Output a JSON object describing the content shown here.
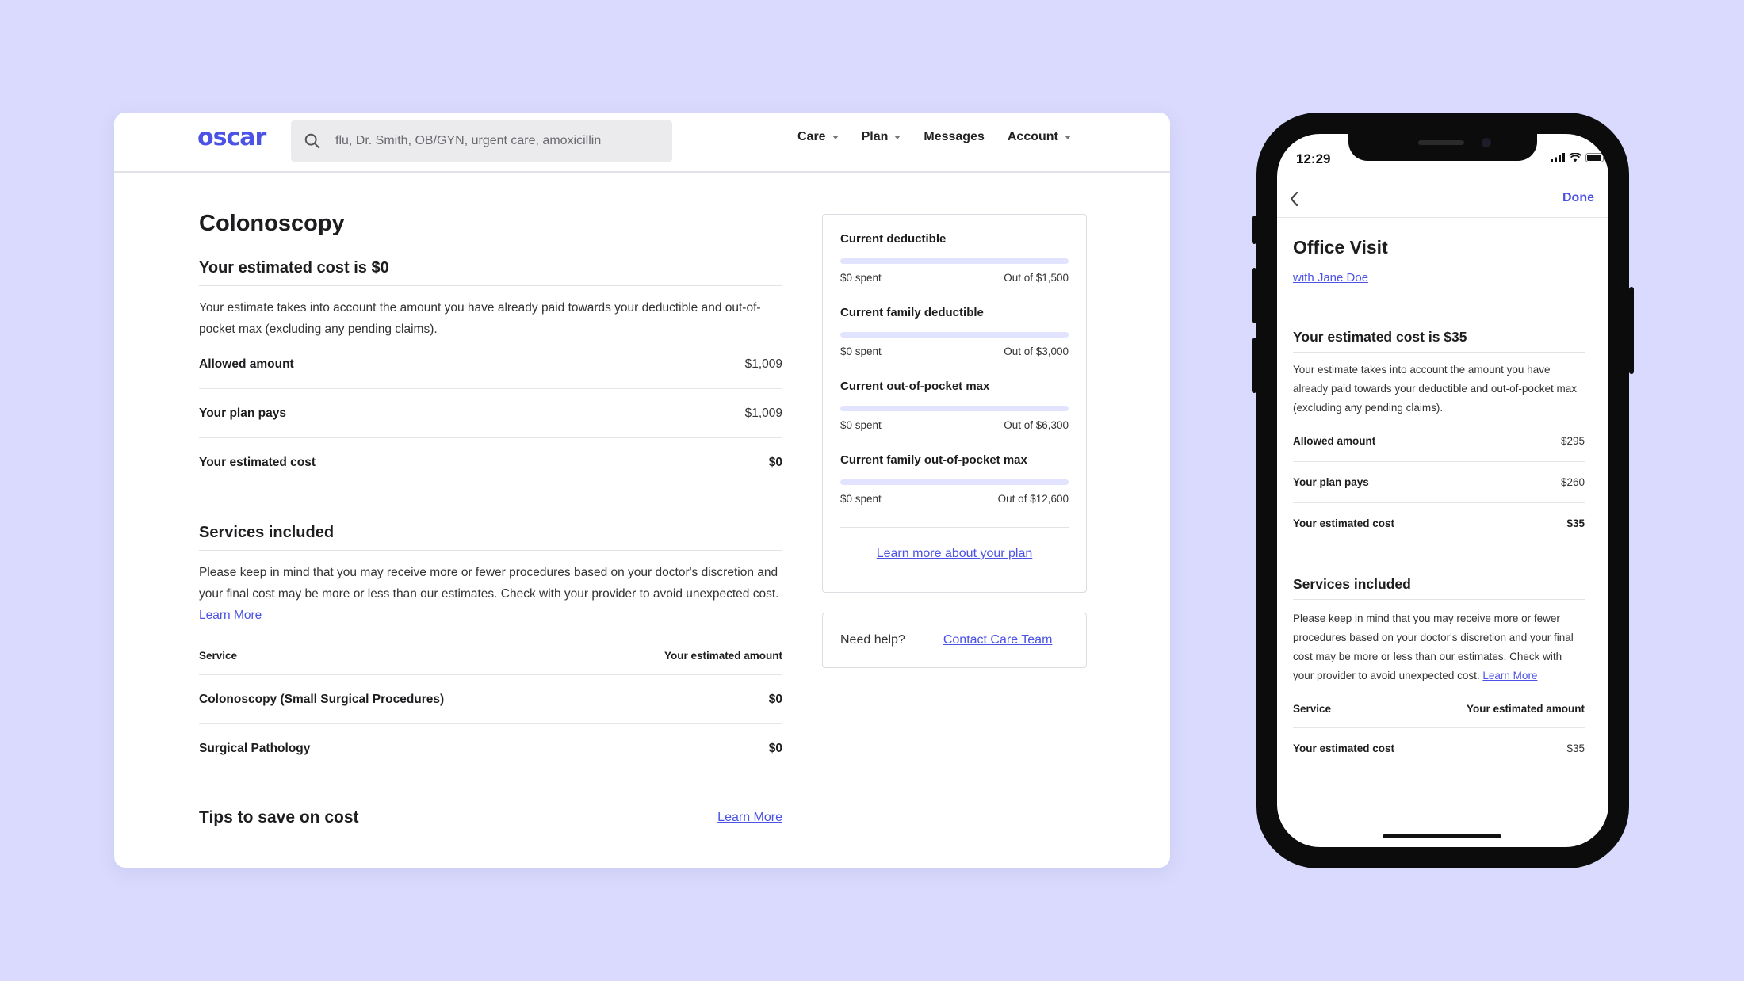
{
  "colors": {
    "accent": "#4c52e3",
    "background": "#d9dafd",
    "meter_track": "#e2e3ff"
  },
  "desktop": {
    "nav": {
      "logo": "oscar",
      "search": {
        "placeholder": "flu, Dr. Smith, OB/GYN, urgent care, amoxicillin",
        "icon": "search-icon"
      },
      "links": [
        {
          "label": "Care",
          "has_caret": true
        },
        {
          "label": "Plan",
          "has_caret": true
        },
        {
          "label": "Messages",
          "has_caret": false
        },
        {
          "label": "Account",
          "has_caret": true
        }
      ]
    },
    "main": {
      "title": "Colonoscopy",
      "estimate_title": "Your estimated cost is $0",
      "estimate_desc": "Your estimate takes into account the amount you have already paid towards your deductible and out-of-pocket max (excluding any pending claims).",
      "cost_rows": [
        {
          "label": "Allowed amount",
          "value": "$1,009",
          "bold": false
        },
        {
          "label": "Your plan pays",
          "value": "$1,009",
          "bold": false
        },
        {
          "label": "Your estimated cost",
          "value": "$0",
          "bold": true
        }
      ],
      "services_title": "Services included",
      "services_desc": "Please keep in mind that you may receive more or fewer procedures based on your doctor's discretion and your final cost may be more or less than our estimates. Check with your provider to avoid unexpected cost.",
      "services_learn_more": "Learn More",
      "services_table": {
        "col_service": "Service",
        "col_amount": "Your estimated amount",
        "rows": [
          {
            "service": "Colonoscopy (Small Surgical Procedures)",
            "amount": "$0"
          },
          {
            "service": "Surgical Pathology",
            "amount": "$0"
          }
        ]
      },
      "tips_title": "Tips to save on cost",
      "tips_learn_more": "Learn More"
    },
    "sidebar": {
      "meters": [
        {
          "title": "Current deductible",
          "spent": "$0 spent",
          "limit": "Out of $1,500",
          "fraction": 0
        },
        {
          "title": "Current family deductible",
          "spent": "$0 spent",
          "limit": "Out of $3,000",
          "fraction": 0
        },
        {
          "title": "Current out-of-pocket max",
          "spent": "$0 spent",
          "limit": "Out of $6,300",
          "fraction": 0
        },
        {
          "title": "Current family out-of-pocket max",
          "spent": "$0 spent",
          "limit": "Out of $12,600",
          "fraction": 0
        }
      ],
      "plan_link": "Learn more about your plan",
      "help_label": "Need help?",
      "help_link": "Contact Care Team"
    }
  },
  "phone": {
    "status": {
      "time": "12:29"
    },
    "header": {
      "done": "Done"
    },
    "title": "Office Visit",
    "provider_link": "with Jane Doe",
    "estimate_title": "Your estimated cost is $35",
    "estimate_desc": "Your estimate takes into account the amount you have already paid towards your deductible and out-of-pocket max (excluding any pending claims).",
    "cost_rows": [
      {
        "label": "Allowed amount",
        "value": "$295",
        "bold": false
      },
      {
        "label": "Your plan pays",
        "value": "$260",
        "bold": false
      },
      {
        "label": "Your estimated cost",
        "value": "$35",
        "bold": true
      }
    ],
    "services_title": "Services included",
    "services_desc": "Please keep in mind that you may receive more or fewer procedures based on your doctor's discretion and your final cost may be more or less than our estimates. Check with your provider to avoid unexpected cost.",
    "services_learn_more": "Learn More",
    "services_table": {
      "col_service": "Service",
      "col_amount": "Your estimated amount",
      "rows": [
        {
          "service": "Your estimated cost",
          "amount": "$35"
        }
      ]
    }
  }
}
